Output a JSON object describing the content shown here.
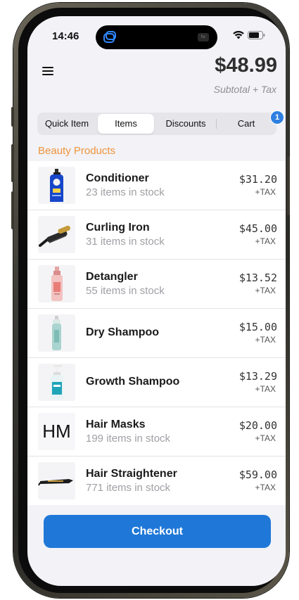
{
  "status_bar": {
    "time": "14:46",
    "tv_label": "tv"
  },
  "header": {
    "total": "$48.99",
    "subtotal_label": "Subtotal + Tax"
  },
  "tabs": [
    {
      "label": "Quick Item",
      "active": false
    },
    {
      "label": "Items",
      "active": true
    },
    {
      "label": "Discounts",
      "active": false
    },
    {
      "label": "Cart",
      "active": false
    }
  ],
  "cart_badge": "1",
  "section_title": "Beauty Products",
  "items": [
    {
      "name": "Conditioner",
      "stock": "23 items in stock",
      "price": "$31.20",
      "tax": "+TAX",
      "icon": "conditioner-bottle-icon"
    },
    {
      "name": "Curling Iron",
      "stock": "31 items in stock",
      "price": "$45.00",
      "tax": "+TAX",
      "icon": "curling-iron-icon"
    },
    {
      "name": "Detangler",
      "stock": "55 items in stock",
      "price": "$13.52",
      "tax": "+TAX",
      "icon": "spray-bottle-icon"
    },
    {
      "name": "Dry Shampoo",
      "stock": "",
      "price": "$15.00",
      "tax": "+TAX",
      "icon": "dry-shampoo-can-icon"
    },
    {
      "name": "Growth Shampoo",
      "stock": "",
      "price": "$13.29",
      "tax": "+TAX",
      "icon": "pump-bottle-icon"
    },
    {
      "name": "Hair Masks",
      "stock": "199 items in stock",
      "price": "$20.00",
      "tax": "+TAX",
      "thumb_text": "HM"
    },
    {
      "name": "Hair Straightener",
      "stock": "771 items in stock",
      "price": "$59.00",
      "tax": "+TAX",
      "icon": "hair-straightener-icon"
    }
  ],
  "checkout_label": "Checkout",
  "colors": {
    "accent": "#1f78d8",
    "section": "#f0943a",
    "badge": "#2f7fe0"
  }
}
